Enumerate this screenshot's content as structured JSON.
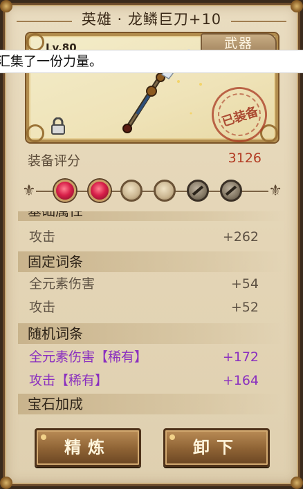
{
  "title": "英雄 · 龙鳞巨刀+10",
  "category_tab": "武器",
  "level_tag": "Lv.80",
  "notice_text": "汇集了一份力量。",
  "equipped_stamp": "已装备",
  "score": {
    "label": "装备评分",
    "value": "3126"
  },
  "gems": [
    {
      "state": "ruby"
    },
    {
      "state": "ruby"
    },
    {
      "state": "empty"
    },
    {
      "state": "empty"
    },
    {
      "state": "locked"
    },
    {
      "state": "locked"
    }
  ],
  "sections": {
    "base": {
      "header": "基础属性",
      "rows": [
        {
          "name": "攻击",
          "value": "+262"
        }
      ]
    },
    "fixed": {
      "header": "固定词条",
      "rows": [
        {
          "name": "全元素伤害",
          "value": "+54"
        },
        {
          "name": "攻击",
          "value": "+52"
        }
      ]
    },
    "random": {
      "header": "随机词条",
      "rows": [
        {
          "name": "全元素伤害【稀有】",
          "value": "+172"
        },
        {
          "name": "攻击【稀有】",
          "value": "+164"
        }
      ]
    },
    "gem_bonus": {
      "header": "宝石加成"
    }
  },
  "buttons": {
    "refine": "精炼",
    "unequip": "卸下"
  },
  "colors": {
    "score_value": "#b23a22",
    "rare_text": "#8a2fbf",
    "plain_text": "#5e5244"
  }
}
